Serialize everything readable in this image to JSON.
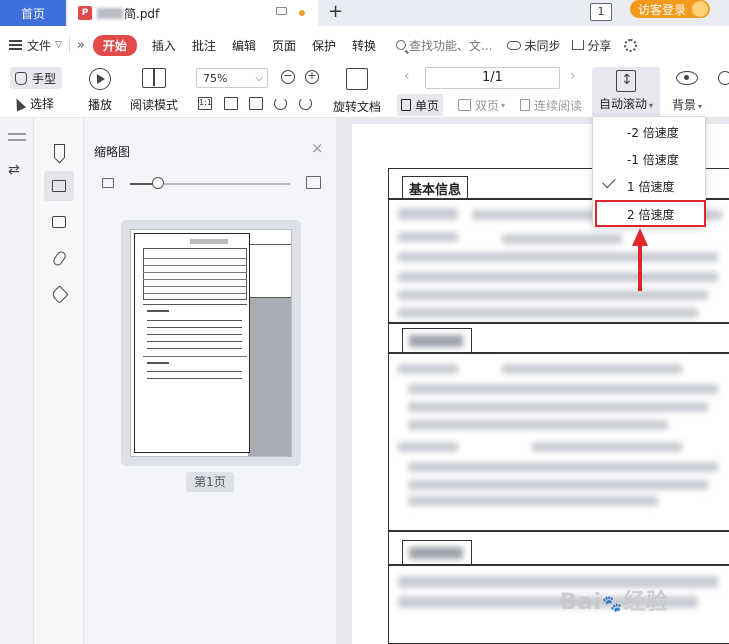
{
  "tabs": {
    "home": "首页",
    "doc_suffix": "简.pdf",
    "add": "+",
    "page_count_badge": "1",
    "guest_login": "访客登录"
  },
  "menu": {
    "file": "文件",
    "more": "»",
    "start": "开始",
    "items": [
      "插入",
      "批注",
      "编辑",
      "页面",
      "保护",
      "转换"
    ],
    "search": "查找功能、文...",
    "unsync": "未同步",
    "share": "分享"
  },
  "toolbar": {
    "hand": "手型",
    "select": "选择",
    "play": "播放",
    "read_mode": "阅读模式",
    "zoom": "75%",
    "zoom_dropdown": "⌵",
    "actual_size": "1:1",
    "rotate_doc": "旋转文档",
    "page_indicator": "1/1",
    "single_page": "单页",
    "double_page": "双页",
    "continuous": "连续阅读",
    "auto_scroll": "自动滚动",
    "background": "背景"
  },
  "thumbnail_panel": {
    "title": "缩略图",
    "close": "×",
    "page_label": "第1页"
  },
  "document": {
    "section_basic": "基本信息"
  },
  "scroll_speed_menu": {
    "items": [
      {
        "label": "-2 倍速度",
        "checked": false
      },
      {
        "label": "-1 倍速度",
        "checked": false
      },
      {
        "label": "1 倍速度",
        "checked": true
      },
      {
        "label": "2 倍速度",
        "checked": false,
        "highlighted": true
      }
    ]
  },
  "colors": {
    "accent_blue": "#3f6fd8",
    "start_red": "#e34b4b",
    "guest_orange": "#f39a1d",
    "highlight_red": "#e0262a"
  },
  "watermark": "Bai 经验"
}
